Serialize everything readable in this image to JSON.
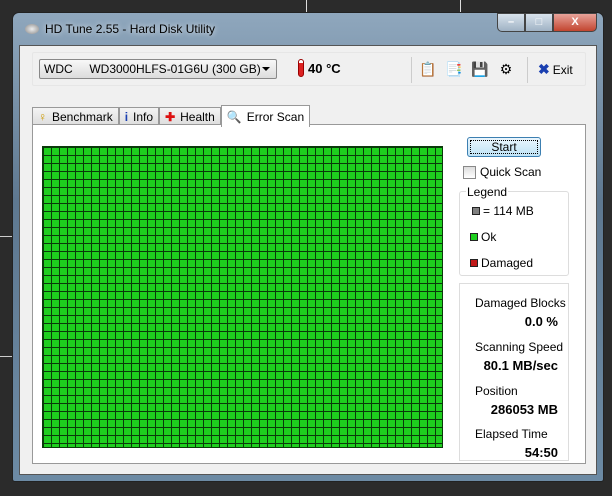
{
  "window": {
    "title": "HD Tune 2.55 - Hard Disk Utility",
    "minimize": "–",
    "maximize": "□",
    "close": "X"
  },
  "toolbar": {
    "drive": "WDC     WD3000HLFS-01G6U (300 GB)",
    "temperature": "40 °C",
    "exit_label": "Exit",
    "icons": [
      "copy-icon",
      "copy-all-icon",
      "save-icon",
      "options-icon"
    ]
  },
  "tabs": [
    {
      "label": "Benchmark",
      "icon": "benchmark-icon"
    },
    {
      "label": "Info",
      "icon": "info-icon"
    },
    {
      "label": "Health",
      "icon": "health-icon"
    },
    {
      "label": "Error Scan",
      "icon": "search-icon",
      "active": true
    }
  ],
  "scan": {
    "start_label": "Start",
    "quick_scan_label": "Quick Scan",
    "quick_scan_checked": false,
    "legend": {
      "title": "Legend",
      "block": "= 114 MB",
      "ok": "Ok",
      "damaged": "Damaged"
    },
    "colors": {
      "ok": "#1ecf1e",
      "damaged": "#c01818",
      "block": "#808080"
    },
    "stats": {
      "damaged_blocks_label": "Damaged Blocks",
      "damaged_blocks": "0.0 %",
      "speed_label": "Scanning Speed",
      "speed": "80.1 MB/sec",
      "position_label": "Position",
      "position": "286053 MB",
      "elapsed_label": "Elapsed Time",
      "elapsed": "54:50"
    }
  }
}
